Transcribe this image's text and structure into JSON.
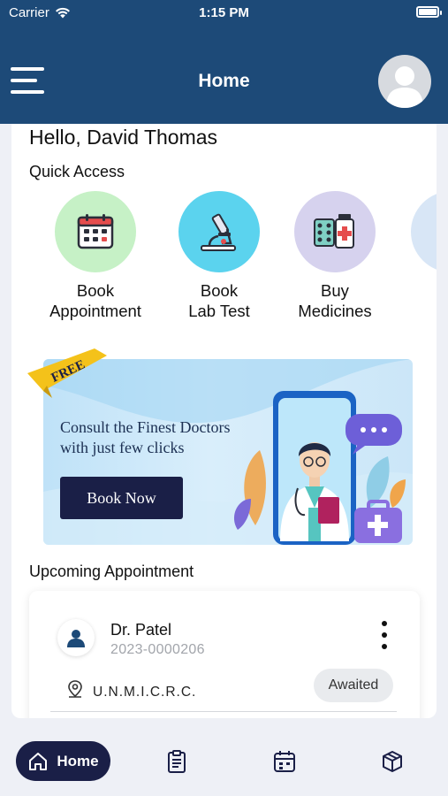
{
  "status_bar": {
    "carrier": "Carrier",
    "time": "1:15 PM"
  },
  "header": {
    "title": "Home"
  },
  "greeting": "Hello, David Thomas",
  "quick_access": {
    "title": "Quick Access",
    "items": [
      {
        "line1": "Book",
        "line2": "Appointment",
        "icon": "calendar-icon",
        "color": "#c6f1c6"
      },
      {
        "line1": "Book",
        "line2": "Lab Test",
        "icon": "microscope-icon",
        "color": "#5bd3ee"
      },
      {
        "line1": "Buy",
        "line2": "Medicines",
        "icon": "medicine-icon",
        "color": "#d6d2ee"
      }
    ]
  },
  "banner": {
    "ribbon": "FREE",
    "line1": "Consult the Finest Doctors",
    "line2": "with just few clicks",
    "button": "Book Now"
  },
  "upcoming": {
    "title": "Upcoming Appointment",
    "doctor": "Dr. Patel",
    "id": "2023-0000206",
    "location": "U.N.M.I.C.R.C.",
    "status": "Awaited"
  },
  "bottom_nav": {
    "home_label": "Home"
  },
  "colors": {
    "primary": "#1d4a78",
    "dark": "#1a1f47"
  }
}
